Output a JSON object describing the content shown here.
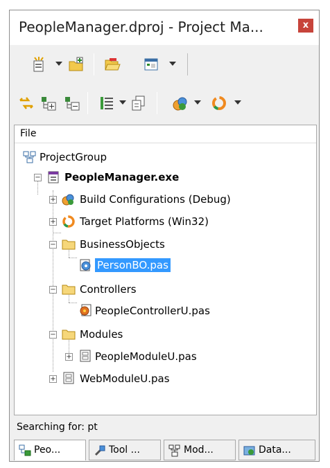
{
  "window": {
    "title": "PeopleManager.dproj - Project Ma...",
    "close_label": "x"
  },
  "toolbar1": {
    "buttons": [
      "new-item-icon",
      "add-to-project-icon",
      "open-folder-icon",
      "view-icon"
    ]
  },
  "toolbar2": {
    "buttons": [
      "sync-icon",
      "expand-icon",
      "collapse-icon",
      "build-order-icon",
      "rebuild-icon",
      "build-config-icon",
      "target-platform-icon"
    ]
  },
  "tree": {
    "column_header": "File",
    "nodes": [
      {
        "label": "ProjectGroup",
        "icon": "project-group-icon"
      },
      {
        "label": "PeopleManager.exe",
        "icon": "project-exe-icon",
        "bold": true
      },
      {
        "label": "Build Configurations (Debug)",
        "icon": "build-config-icon"
      },
      {
        "label": "Target Platforms (Win32)",
        "icon": "target-platform-icon"
      },
      {
        "label": "BusinessObjects",
        "icon": "folder-icon"
      },
      {
        "label": "PersonBO.pas",
        "icon": "unit-file-icon",
        "selected": true
      },
      {
        "label": "Controllers",
        "icon": "folder-icon"
      },
      {
        "label": "PeopleControllerU.pas",
        "icon": "controller-unit-icon"
      },
      {
        "label": "Modules",
        "icon": "folder-icon"
      },
      {
        "label": "PeopleModuleU.pas",
        "icon": "module-unit-icon"
      },
      {
        "label": "WebModuleU.pas",
        "icon": "module-unit-icon"
      }
    ]
  },
  "status": {
    "text": "Searching for: pt"
  },
  "tabs": [
    {
      "label": "Peo...",
      "icon": "project-manager-icon",
      "active": true
    },
    {
      "label": "Tool ...",
      "icon": "tool-palette-icon"
    },
    {
      "label": "Mod...",
      "icon": "model-view-icon"
    },
    {
      "label": "Data...",
      "icon": "data-explorer-icon"
    }
  ],
  "colors": {
    "selection": "#3399ff",
    "close_button": "#c7443b"
  }
}
